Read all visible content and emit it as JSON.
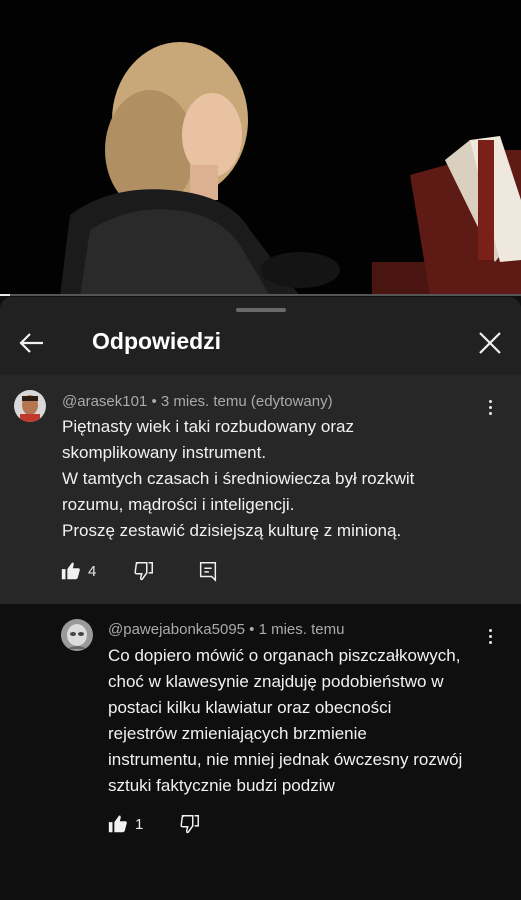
{
  "header": {
    "title": "Odpowiedzi"
  },
  "comments": [
    {
      "author": "@arasek101",
      "separator": " • ",
      "time": "3 mies. temu (edytowany)",
      "lines": [
        "Piętnasty wiek i taki rozbudowany oraz",
        "skomplikowany instrument.",
        "W tamtych czasach i średniowiecza był rozkwit",
        "rozumu, mądrości i inteligencji.",
        "Proszę zestawić dzisiejszą kulturę z minioną."
      ],
      "likes": "4"
    },
    {
      "author": "@pawejabonka5095",
      "separator": " • ",
      "time": "1 mies. temu",
      "lines": [
        "Co dopiero mówić o organach piszczałkowych,",
        "choć w klawesynie znajduję podobieństwo w",
        "postaci kilku klawiatur oraz obecności",
        "rejestrów zmieniających brzmienie",
        "instrumentu, nie mniej jednak ówczesny rozwój",
        "sztuki faktycznie budzi podziw"
      ],
      "likes": "1"
    }
  ],
  "video": {
    "progress_fraction": 0.02
  },
  "icons": [
    "back-arrow-icon",
    "close-icon",
    "more-vert-icon",
    "thumb-up-icon",
    "thumb-down-icon",
    "reply-icon"
  ]
}
